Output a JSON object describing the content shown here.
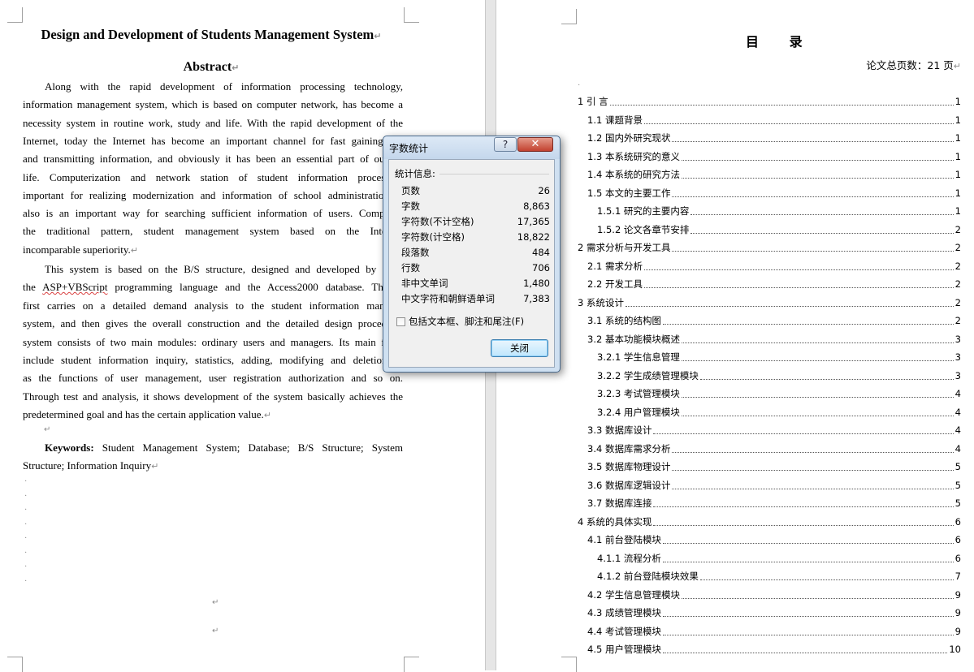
{
  "left_page": {
    "title": "Design and Development of Students Management System",
    "abstract_heading": "Abstract",
    "para1_lines": [
      "Along with the rapid development of information processing technology,",
      "information management system, which is based on computer network, has become a",
      "necessity system in routine work, study and life. With the rapid development of the",
      "Internet, today the Internet has become an important channel for fast gaining, iss",
      "and transmitting information, and obviously it has been an essential part of our so",
      "life. Computerization and network station of student information processing",
      "important for realizing modernization and information of school administration, a",
      "also is an important way for searching sufficient information of users. Compared",
      "the traditional pattern, student management system based on the Internet",
      "incomparable superiority."
    ],
    "para2_line1": "This system is based on the B/S structure, designed and developed by adop",
    "para2_line2_pre": "the ",
    "para2_line2_flag": "ASP+VBScript",
    "para2_line2_post": " programming language and the Access2000 database. This p",
    "para2_lines_rest": [
      "first carries on a detailed demand analysis to the student information manager",
      "system, and then gives the overall construction and the detailed design procedure.",
      "system consists of two main modules: ordinary users and managers. Its main funct",
      "include student information inquiry, statistics, adding, modifying and deletion as",
      "as the functions of user management, user registration authorization and so on.",
      "Through test and analysis, it shows development of the system basically achieves the",
      "predetermined goal and has the certain application value."
    ],
    "keywords_label": "Keywords:",
    "keywords_line1": " Student Management System; Database; B/S Structure; System",
    "keywords_line2": "Structure; Information Inquiry"
  },
  "right_page": {
    "toc_title": "目 录",
    "total_pages": "论文总页数：21 页",
    "toc": [
      {
        "label": "1 引 言",
        "page": "1"
      },
      {
        "label": "1.1 课题背景",
        "page": "1"
      },
      {
        "label": "1.2 国内外研究现状",
        "page": "1"
      },
      {
        "label": "1.3 本系统研究的意义",
        "page": "1"
      },
      {
        "label": "1.4 本系统的研究方法",
        "page": "1"
      },
      {
        "label": "1.5 本文的主要工作",
        "page": "1"
      },
      {
        "label": "1.5.1 研究的主要内容",
        "page": "1"
      },
      {
        "label": "1.5.2 论文各章节安排",
        "page": "2"
      },
      {
        "label": "2 需求分析与开发工具",
        "page": "2"
      },
      {
        "label": "2.1 需求分析",
        "page": "2"
      },
      {
        "label": "2.2 开发工具",
        "page": "2"
      },
      {
        "label": "3 系统设计",
        "page": "2"
      },
      {
        "label": "3.1 系统的结构图",
        "page": "2"
      },
      {
        "label": "3.2 基本功能模块概述",
        "page": "3"
      },
      {
        "label": "3.2.1 学生信息管理",
        "page": "3"
      },
      {
        "label": "3.2.2 学生成绩管理模块",
        "page": "3"
      },
      {
        "label": "3.2.3 考试管理模块",
        "page": "4"
      },
      {
        "label": "3.2.4 用户管理模块",
        "page": "4"
      },
      {
        "label": "3.3 数据库设计",
        "page": "4"
      },
      {
        "label": "3.4 数据库需求分析",
        "page": "4"
      },
      {
        "label": "3.5 数据库物理设计",
        "page": "5"
      },
      {
        "label": "3.6 数据库逻辑设计",
        "page": "5"
      },
      {
        "label": "3.7 数据库连接",
        "page": "5"
      },
      {
        "label": "4 系统的具体实现",
        "page": "6"
      },
      {
        "label": "4.1 前台登陆模块",
        "page": "6"
      },
      {
        "label": "4.1.1 流程分析",
        "page": "6"
      },
      {
        "label": "4.1.2 前台登陆模块效果",
        "page": "7"
      },
      {
        "label": "4.2 学生信息管理模块",
        "page": "9"
      },
      {
        "label": "4.3 成绩管理模块",
        "page": "9"
      },
      {
        "label": "4.4 考试管理模块",
        "page": "9"
      },
      {
        "label": "4.5 用户管理模块",
        "page": "10"
      }
    ]
  },
  "dialog": {
    "title": "字数统计",
    "help_label": "?",
    "close_x_label": "✕",
    "group_label": "统计信息:",
    "stats": [
      {
        "label": "页数",
        "value": "26"
      },
      {
        "label": "字数",
        "value": "8,863"
      },
      {
        "label": "字符数(不计空格)",
        "value": "17,365"
      },
      {
        "label": "字符数(计空格)",
        "value": "18,822"
      },
      {
        "label": "段落数",
        "value": "484"
      },
      {
        "label": "行数",
        "value": "706"
      },
      {
        "label": "非中文单词",
        "value": "1,480"
      },
      {
        "label": "中文字符和朝鲜语单词",
        "value": "7,383"
      }
    ],
    "checkbox_label": "包括文本框、脚注和尾注(F)",
    "checkbox_checked": false,
    "close_button": "关闭"
  },
  "marks": {
    "paragraph": "↵",
    "empty": "·"
  },
  "colors": {
    "gutter": "#e6e6e6",
    "dialog_frame": "#cfe0f1",
    "spellcheck": "#d94040"
  }
}
